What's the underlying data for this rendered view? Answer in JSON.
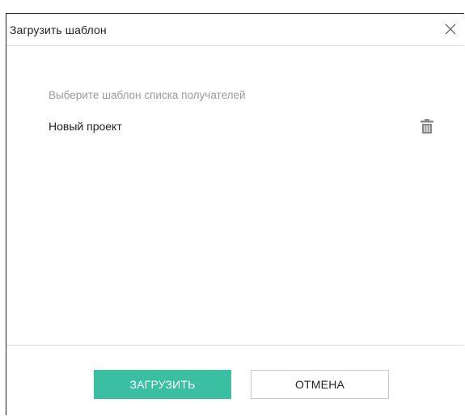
{
  "dialog": {
    "title": "Загрузить шаблон",
    "close_icon": "close-icon",
    "hint": "Выберите шаблон списка получателей",
    "templates": [
      {
        "label": "Новый проект",
        "delete_icon": "trash-icon"
      }
    ],
    "buttons": {
      "load": "ЗАГРУЗИТЬ",
      "cancel": "ОТМЕНА"
    }
  },
  "colors": {
    "primary": "#3bbfa3",
    "hint_text": "#9b9b9b",
    "text": "#222222",
    "divider": "#dcdcdc",
    "icon": "#8a8a8a"
  }
}
